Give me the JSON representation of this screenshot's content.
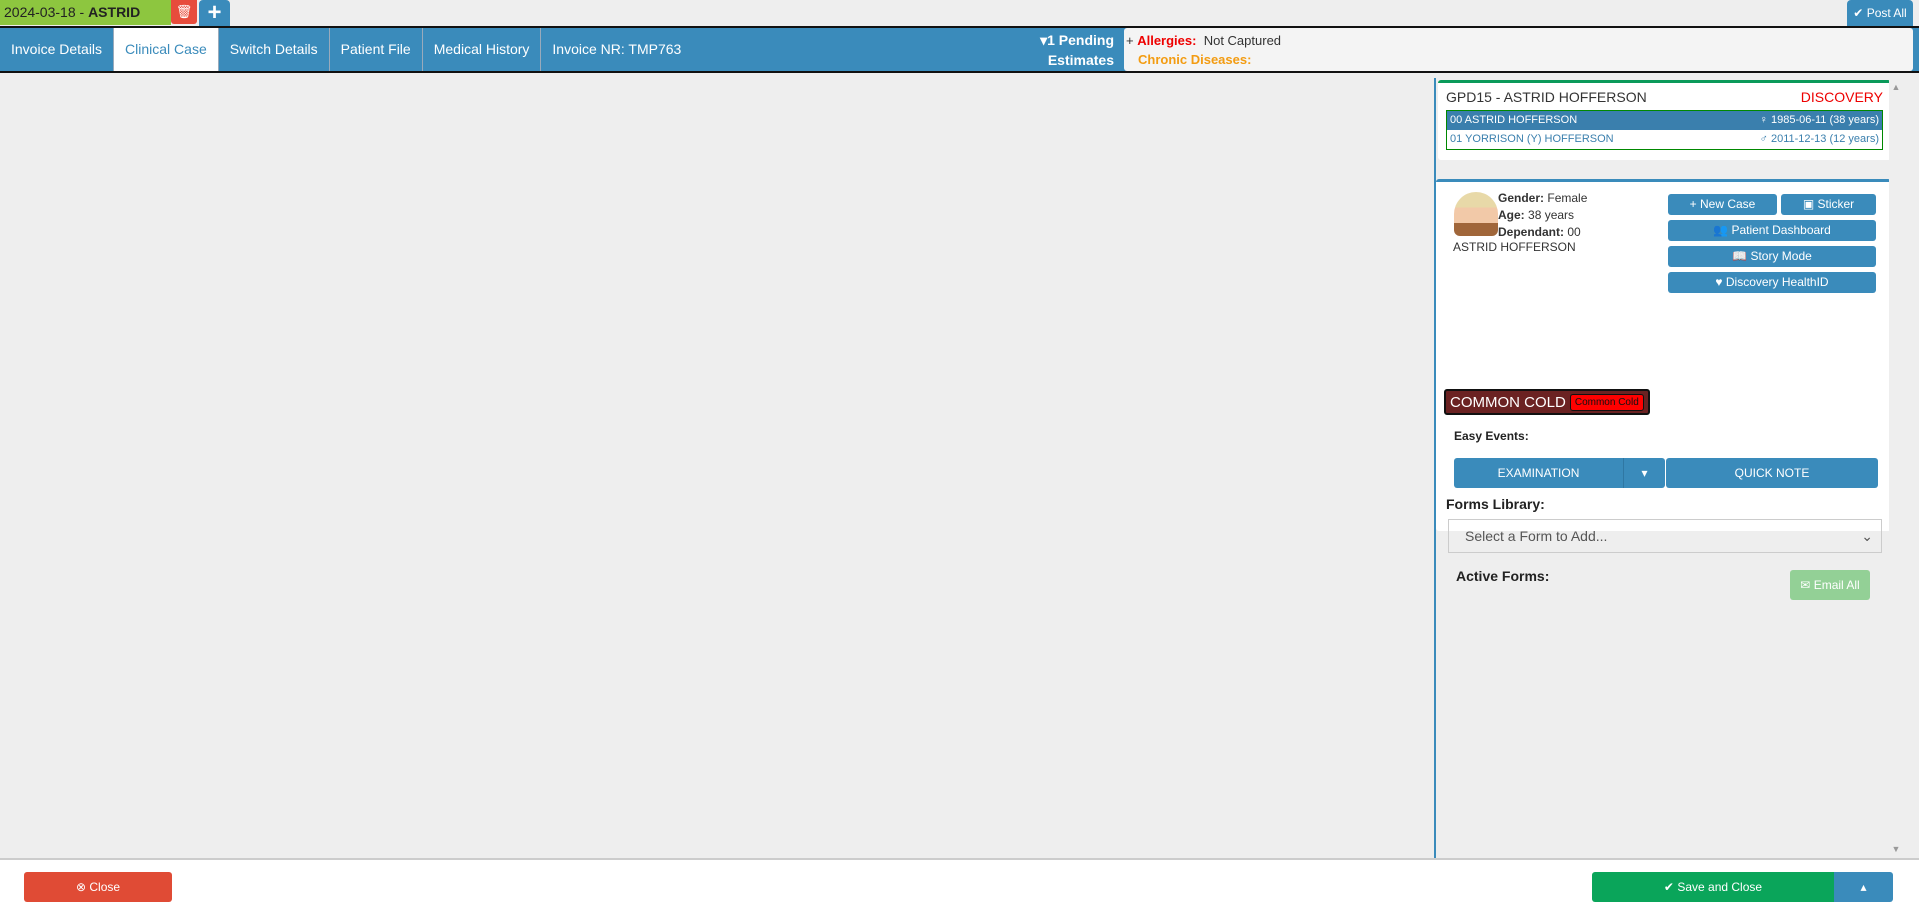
{
  "top_tab": {
    "date": "2024-03-18 - ",
    "name": "ASTRID"
  },
  "post_all": "Post All",
  "nav": {
    "tabs": [
      "Invoice Details",
      "Clinical Case",
      "Switch Details",
      "Patient File",
      "Medical History",
      "Invoice NR: TMP763"
    ],
    "pending_line1": "1 Pending",
    "pending_line2": "Estimates"
  },
  "alerts": {
    "plus": "+",
    "allergies_label": "Allergies:",
    "allergies_value": "Not Captured",
    "chronic_label": "Chronic Diseases:"
  },
  "patient": {
    "header": "GPD15 - ASTRID HOFFERSON",
    "scheme": "DISCOVERY",
    "dependants": [
      {
        "name": "00 ASTRID HOFFERSON",
        "dob": "1985-06-11 (38 years)"
      },
      {
        "name": "01 YORRISON (Y) HOFFERSON",
        "dob": "2011-12-13 (12 years)"
      }
    ],
    "gender_label": "Gender:",
    "gender": "Female",
    "age_label": "Age:",
    "age": "38 years",
    "dependant_label": "Dependant:",
    "dependant": "00",
    "full_name": "ASTRID HOFFERSON"
  },
  "actions": {
    "new_case": "New Case",
    "sticker": "Sticker",
    "dashboard": "Patient Dashboard",
    "story": "Story Mode",
    "healthid": "Discovery HealthID"
  },
  "case": {
    "title": "COMMON COLD",
    "tag": "Common Cold"
  },
  "easy_events": {
    "label": "Easy Events:",
    "examination": "EXAMINATION",
    "quick_note": "QUICK NOTE"
  },
  "forms": {
    "label": "Forms Library:",
    "placeholder": "Select a Form to Add...",
    "active_label": "Active Forms:",
    "email_all": "Email All"
  },
  "footer": {
    "close": "Close",
    "save_close": "Save and Close"
  }
}
